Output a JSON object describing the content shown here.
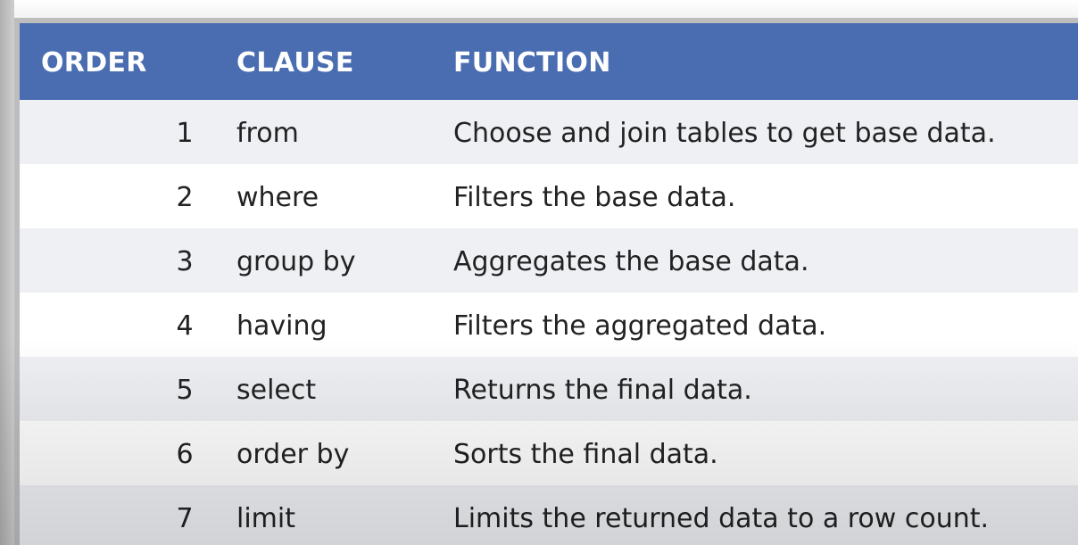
{
  "table": {
    "headers": {
      "order": "ORDER",
      "clause": "CLAUSE",
      "function": "FUNCTION"
    },
    "rows": [
      {
        "order": "1",
        "clause": "from",
        "function": "Choose and join tables to get base data."
      },
      {
        "order": "2",
        "clause": "where",
        "function": "Filters the base data."
      },
      {
        "order": "3",
        "clause": "group by",
        "function": "Aggregates the base data."
      },
      {
        "order": "4",
        "clause": "having",
        "function": "Filters the aggregated data."
      },
      {
        "order": "5",
        "clause": "select",
        "function": "Returns the final data."
      },
      {
        "order": "6",
        "clause": "order by",
        "function": "Sorts the final data."
      },
      {
        "order": "7",
        "clause": "limit",
        "function": "Limits the returned data to a row count."
      }
    ],
    "colors": {
      "header_bg": "#4a6db1",
      "header_text": "#ffffff",
      "row_odd_bg": "#eef0f4",
      "row_even_bg": "#ffffff",
      "body_text": "#222222"
    }
  }
}
